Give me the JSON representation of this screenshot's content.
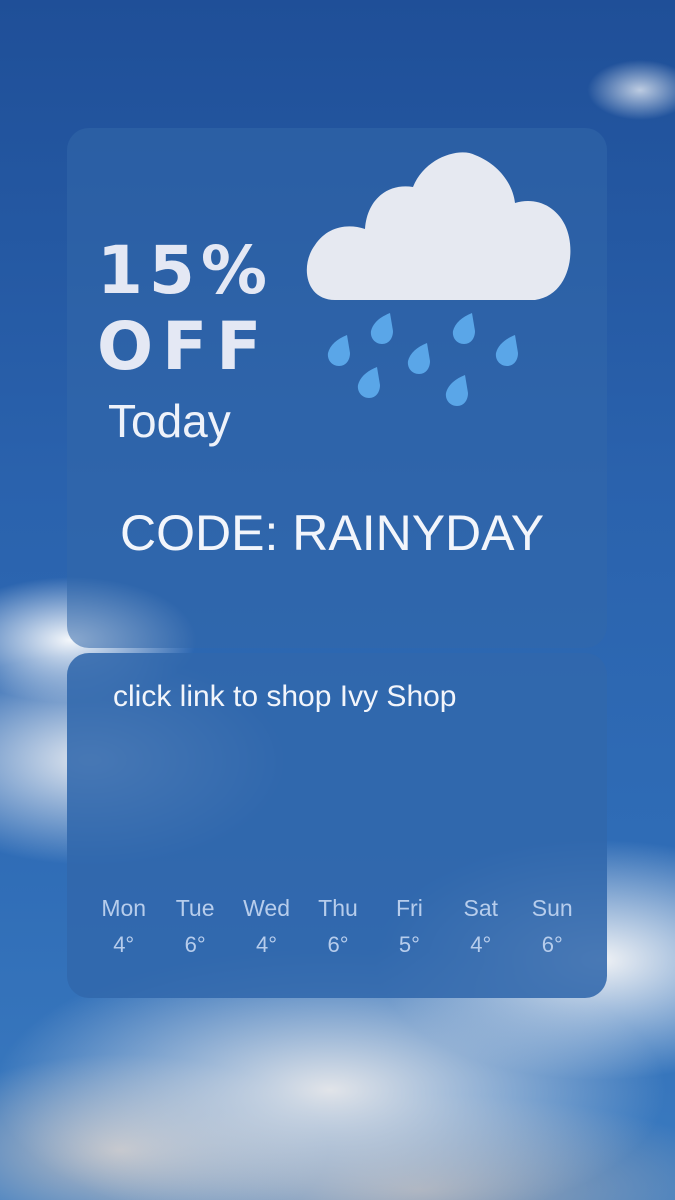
{
  "promo": {
    "discount": "15%",
    "off": "OFF",
    "when": "Today",
    "code": "CODE: RAINYDAY",
    "link": "click link to shop Ivy Shop"
  },
  "icons": {
    "weather": "rain-cloud-icon"
  },
  "colors": {
    "raindrop": "#5aa6e8",
    "cloud": "#e6e9f1"
  },
  "forecast": [
    {
      "day": "Mon",
      "temp": "4°"
    },
    {
      "day": "Tue",
      "temp": "6°"
    },
    {
      "day": "Wed",
      "temp": "4°"
    },
    {
      "day": "Thu",
      "temp": "6°"
    },
    {
      "day": "Fri",
      "temp": "5°"
    },
    {
      "day": "Sat",
      "temp": "4°"
    },
    {
      "day": "Sun",
      "temp": "6°"
    }
  ]
}
